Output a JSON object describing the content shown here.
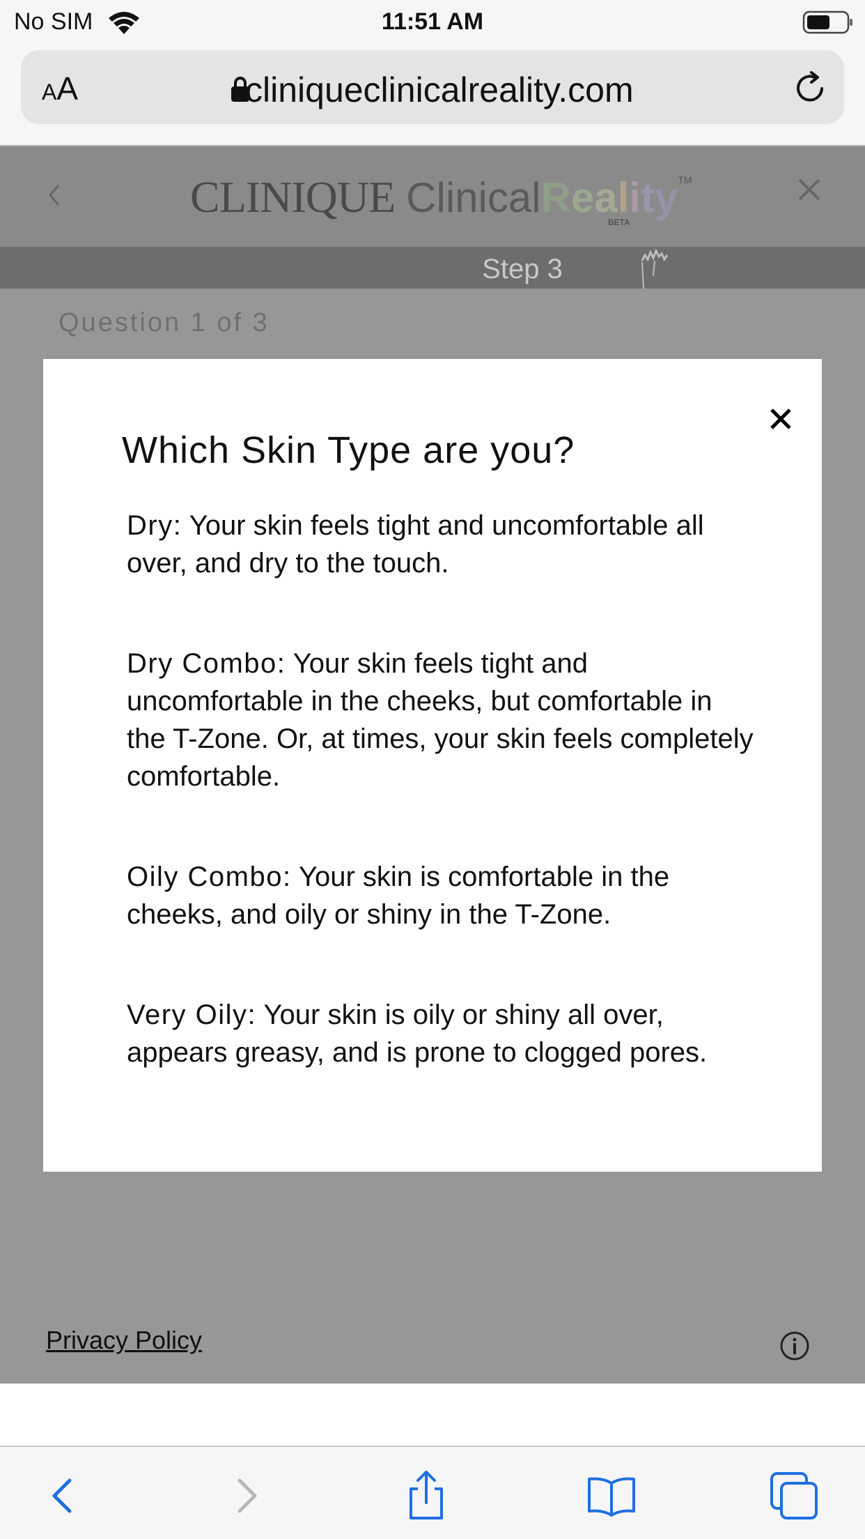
{
  "status_bar": {
    "carrier": "No SIM",
    "time": "11:51 AM",
    "icons": [
      "wifi-icon",
      "battery-icon"
    ]
  },
  "browser": {
    "text_size_button": {
      "small": "A",
      "large": "A"
    },
    "url": "cliniqueclinicalreality.com",
    "icons": [
      "lock-icon",
      "reload-icon"
    ]
  },
  "header": {
    "logo": {
      "brand": "CLINIQUE",
      "clinical": "Clinical",
      "reality_letters": [
        "R",
        "e",
        "a",
        "l",
        "i",
        "t",
        "y"
      ],
      "reality_colors": [
        "#8f9f8a",
        "#9aa88f",
        "#a6a895",
        "#b0a08e",
        "#a99aa3",
        "#9a96aa",
        "#9493a7"
      ],
      "trademark": "TM",
      "beta": "BETA"
    },
    "icons": [
      "back-icon",
      "close-icon"
    ]
  },
  "step_bar": {
    "label": "Step 3"
  },
  "question": {
    "label": "Question 1 of 3"
  },
  "modal": {
    "title": "Which Skin Type are you?",
    "skin_types": [
      {
        "term": "Dry:",
        "description": "Your skin feels tight and uncomfortable all over, and dry to the touch."
      },
      {
        "term": "Dry Combo:",
        "description": "Your skin feels tight and uncomfortable in the cheeks, but comfortable in the T-Zone. Or, at times, your skin feels completely comfortable."
      },
      {
        "term": "Oily Combo:",
        "description": "Your skin is comfortable in the cheeks, and oily or shiny in the T-Zone."
      },
      {
        "term": "Very Oily:",
        "description": "Your skin is oily or shiny all over, appears greasy, and is prone to clogged pores."
      }
    ],
    "close_icon": "close-icon"
  },
  "footer": {
    "privacy_policy": "Privacy Policy",
    "info_icon": "info-icon"
  },
  "toolbar": {
    "icons": [
      "back-icon",
      "forward-icon",
      "share-icon",
      "bookmarks-icon",
      "tabs-icon"
    ]
  },
  "colors": {
    "overlay": "#979797",
    "header_bg": "#8a8a8a",
    "step_bar_bg": "#6d6d6d",
    "toolbar_blue": "#1f6fe0",
    "toolbar_disabled": "#b8b8bc"
  }
}
